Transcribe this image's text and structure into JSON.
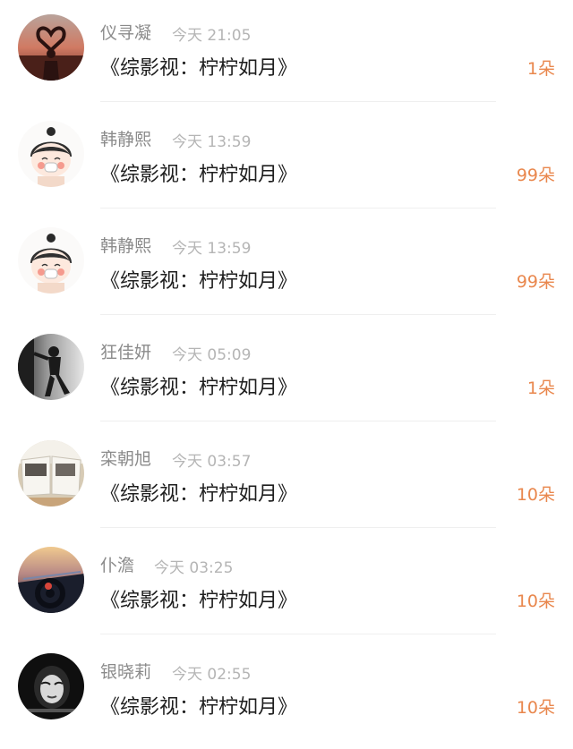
{
  "items": [
    {
      "name": "仪寻凝",
      "time": "今天 21:05",
      "title": "《综影视：柠柠如月》",
      "count": "1朵",
      "avatar": "silhouette-heart-sunset-avatar"
    },
    {
      "name": "韩静熙",
      "time": "今天 13:59",
      "title": "《综影视：柠柠如月》",
      "count": "99朵",
      "avatar": "cartoon-girl-avatar"
    },
    {
      "name": "韩静熙",
      "time": "今天 13:59",
      "title": "《综影视：柠柠如月》",
      "count": "99朵",
      "avatar": "cartoon-girl-avatar"
    },
    {
      "name": "狂佳妍",
      "time": "今天 05:09",
      "title": "《综影视：柠柠如月》",
      "count": "1朵",
      "avatar": "bw-person-leaning-avatar"
    },
    {
      "name": "栾朝旭",
      "time": "今天 03:57",
      "title": "《综影视：柠柠如月》",
      "count": "10朵",
      "avatar": "open-book-avatar"
    },
    {
      "name": "仆澹",
      "time": "今天 03:25",
      "title": "《综影视：柠柠如月》",
      "count": "10朵",
      "avatar": "car-steering-wheel-avatar"
    },
    {
      "name": "银晓莉",
      "time": "今天 02:55",
      "title": "《综影视：柠柠如月》",
      "count": "10朵",
      "avatar": "bw-woman-portrait-avatar"
    }
  ],
  "colors": {
    "name": "#8b8b8b",
    "time": "#b5b5b5",
    "title": "#1e1e1e",
    "count": "#e9874d",
    "divider": "#efefef"
  }
}
